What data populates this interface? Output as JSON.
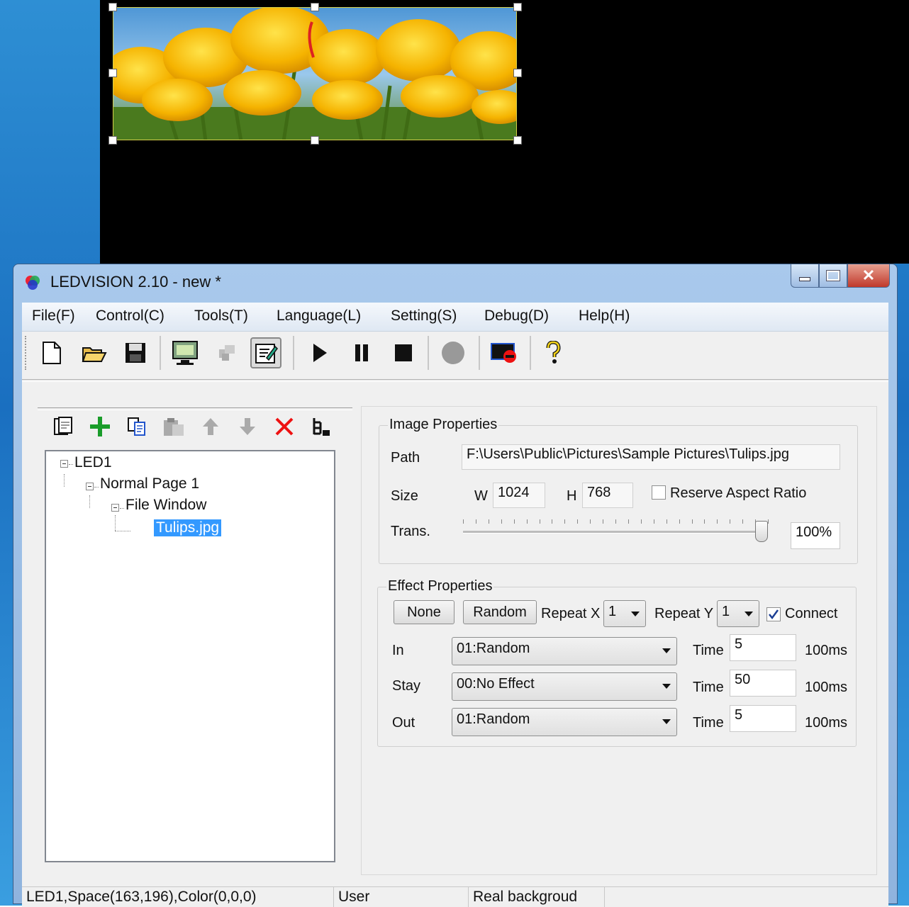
{
  "window": {
    "title": "LEDVISION 2.10 - new *"
  },
  "menu": [
    "File(F)",
    "Control(C)",
    "Tools(T)",
    "Language(L)",
    "Setting(S)",
    "Debug(D)",
    "Help(H)"
  ],
  "toolbar": {
    "icons": [
      "new-file-icon",
      "open-folder-icon",
      "save-icon",
      "display-screen-icon",
      "send-icon",
      "edit-icon",
      "play-icon",
      "pause-icon",
      "stop-icon",
      "record-icon",
      "screen-off-icon",
      "help-icon"
    ]
  },
  "tree_toolbar": {
    "icons": [
      "new-page-icon",
      "add-icon",
      "copy-icon",
      "paste-icon",
      "move-up-icon",
      "move-down-icon",
      "delete-icon",
      "tree-icon"
    ]
  },
  "tree": {
    "nodes": [
      {
        "label": "LED1",
        "level": 0
      },
      {
        "label": "Normal Page 1",
        "level": 1
      },
      {
        "label": "File Window",
        "level": 2
      },
      {
        "label": "Tulips.jpg",
        "level": 3,
        "selected": true
      }
    ]
  },
  "image_properties": {
    "title": "Image Properties",
    "path_label": "Path",
    "path_value": "F:\\Users\\Public\\Pictures\\Sample Pictures\\Tulips.jpg",
    "size_label": "Size",
    "w_label": "W",
    "w_value": "1024",
    "h_label": "H",
    "h_value": "768",
    "reserve_label": "Reserve Aspect Ratio",
    "reserve_checked": false,
    "trans_label": "Trans.",
    "trans_value": "100%",
    "trans_fraction": 1.0
  },
  "effect_properties": {
    "title": "Effect Properties",
    "none_button": "None",
    "random_button": "Random",
    "repeat_x_label": "Repeat X",
    "repeat_x_value": "1",
    "repeat_y_label": "Repeat Y",
    "repeat_y_value": "1",
    "connect_label": "Connect",
    "connect_checked": true,
    "rows": [
      {
        "label": "In",
        "effect": "01:Random",
        "time_label": "Time",
        "time": "5",
        "unit": "100ms"
      },
      {
        "label": "Stay",
        "effect": "00:No Effect",
        "time_label": "Time",
        "time": "50",
        "unit": "100ms"
      },
      {
        "label": "Out",
        "effect": "01:Random",
        "time_label": "Time",
        "time": "5",
        "unit": "100ms"
      }
    ]
  },
  "status": {
    "info": "LED1,Space(163,196),Color(0,0,0)",
    "user": "User",
    "mode": "Real backgroud"
  }
}
